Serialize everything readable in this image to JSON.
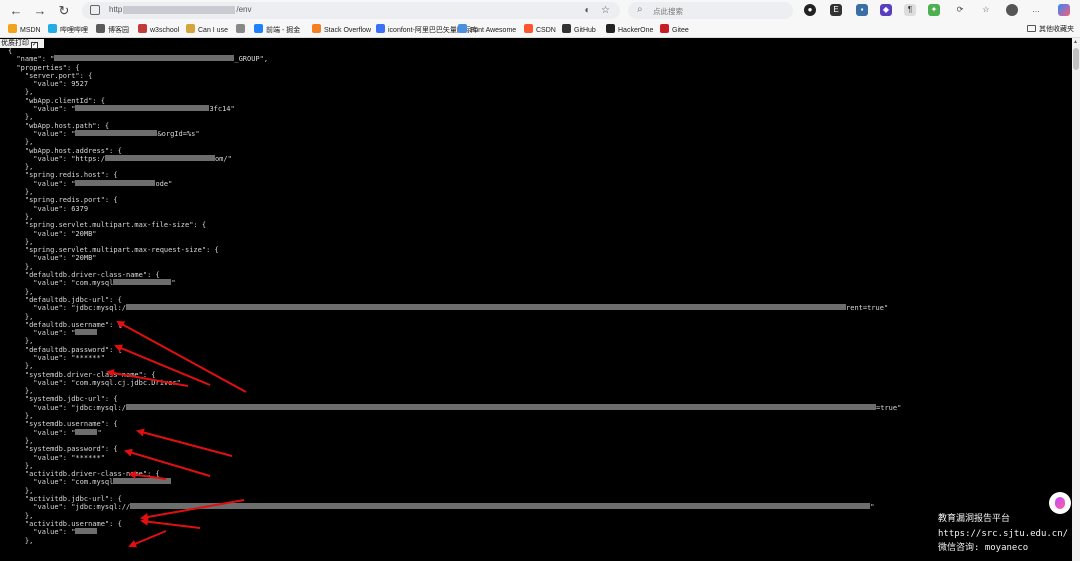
{
  "browser": {
    "url_prefix": "http",
    "url_suffix": "/env",
    "search_placeholder": "点此搜索"
  },
  "bookmarks": [
    {
      "label": "MSDN",
      "color": "#f2a21b"
    },
    {
      "label": "哔哩哔哩",
      "color": "#23ade5"
    },
    {
      "label": "博客园",
      "color": "#5b5b5b"
    },
    {
      "label": "w3school",
      "color": "#c23b3b"
    },
    {
      "label": "Can I use",
      "color": "#d5a53b"
    },
    {
      "label": "",
      "color": "#888888"
    },
    {
      "label": "前端 - 掘金",
      "color": "#1e80ff"
    },
    {
      "label": "Stack Overflow",
      "color": "#f48024"
    },
    {
      "label": "iconfont-阿里巴巴矢量图标库",
      "color": "#3c71f5"
    },
    {
      "label": "Font Awesome",
      "color": "#4a90e2"
    },
    {
      "label": "CSDN",
      "color": "#fc5531"
    },
    {
      "label": "GitHub",
      "color": "#333333"
    },
    {
      "label": "HackerOne",
      "color": "#222222"
    },
    {
      "label": "Gitee",
      "color": "#c71d23"
    }
  ],
  "bookmarks_folder": "其他收藏夹",
  "pretty_print_label": "优质打印",
  "json_lines": [
    {
      "t": "{"
    },
    {
      "t": "  \"name\": \"",
      "r": 180,
      "a": "_GROUP\","
    },
    {
      "t": "  \"properties\": {"
    },
    {
      "t": "    \"server.port\": {"
    },
    {
      "t": "      \"value\": 9527"
    },
    {
      "t": "    },"
    },
    {
      "t": "    \"wbApp.clientId\": {"
    },
    {
      "t": "      \"value\": \"",
      "r": 134,
      "a": "3fc14\""
    },
    {
      "t": "    },"
    },
    {
      "t": "    \"wbApp.host.path\": {"
    },
    {
      "t": "      \"value\": \"",
      "r": 82,
      "a": "&orgId=%s\""
    },
    {
      "t": "    },"
    },
    {
      "t": "    \"wbApp.host.address\": {"
    },
    {
      "t": "      \"value\": \"https:/",
      "r": 110,
      "a": "om/\""
    },
    {
      "t": "    },"
    },
    {
      "t": "    \"spring.redis.host\": {"
    },
    {
      "t": "      \"value\": \"",
      "r": 80,
      "a": "ode\""
    },
    {
      "t": "    },"
    },
    {
      "t": "    \"spring.redis.port\": {"
    },
    {
      "t": "      \"value\": 6379"
    },
    {
      "t": "    },"
    },
    {
      "t": "    \"spring.servlet.multipart.max-file-size\": {"
    },
    {
      "t": "      \"value\": \"20MB\""
    },
    {
      "t": "    },"
    },
    {
      "t": "    \"spring.servlet.multipart.max-request-size\": {"
    },
    {
      "t": "      \"value\": \"20MB\""
    },
    {
      "t": "    },"
    },
    {
      "t": "    \"defaultdb.driver-class-name\": {"
    },
    {
      "t": "      \"value\": \"com.mysql",
      "r": 58,
      "a": "\""
    },
    {
      "t": "    },"
    },
    {
      "t": "    \"defaultdb.jdbc-url\": {"
    },
    {
      "t": "      \"value\": \"jdbc:mysql:/",
      "r": 720,
      "a": "rent=true\""
    },
    {
      "t": "    },"
    },
    {
      "t": "    \"defaultdb.username\": {"
    },
    {
      "t": "      \"value\": \"",
      "r": 22,
      "a": ""
    },
    {
      "t": "    },"
    },
    {
      "t": "    \"defaultdb.password\": {"
    },
    {
      "t": "      \"value\": \"******\""
    },
    {
      "t": "    },"
    },
    {
      "t": "    \"systemdb.driver-class-name\": {"
    },
    {
      "t": "      \"value\": \"com.mysql.cj.jdbc.Driver\""
    },
    {
      "t": "    },"
    },
    {
      "t": "    \"systemdb.jdbc-url\": {"
    },
    {
      "t": "      \"value\": \"jdbc:mysql:/",
      "r": 750,
      "a": "=true\""
    },
    {
      "t": "    },"
    },
    {
      "t": "    \"systemdb.username\": {"
    },
    {
      "t": "      \"value\": \"",
      "r": 22,
      "a": "\""
    },
    {
      "t": "    },"
    },
    {
      "t": "    \"systemdb.password\": {"
    },
    {
      "t": "      \"value\": \"******\""
    },
    {
      "t": "    },"
    },
    {
      "t": "    \"activitdb.driver-class-name\": {"
    },
    {
      "t": "      \"value\": \"com.mysql",
      "r": 58,
      "a": ""
    },
    {
      "t": "    },"
    },
    {
      "t": "    \"activitdb.jdbc-url\": {"
    },
    {
      "t": "      \"value\": \"jdbc:mysql://",
      "r": 740,
      "a": "\""
    },
    {
      "t": "    },"
    },
    {
      "t": "    \"activitdb.username\": {"
    },
    {
      "t": "      \"value\": \"",
      "r": 22,
      "a": ""
    },
    {
      "t": "    },"
    }
  ],
  "watermark": {
    "line1": "教育漏洞报告平台",
    "line2": "https://src.sjtu.edu.cn/",
    "line3": "微信咨询: moyaneco"
  },
  "colors": {
    "annotation_arrow": "#e01010",
    "page_background": "#000000",
    "code_text": "#d9d9d9"
  }
}
